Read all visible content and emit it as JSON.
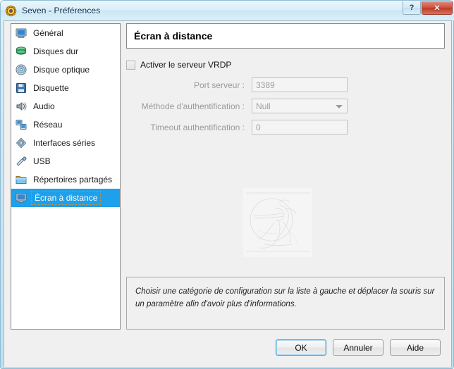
{
  "window": {
    "title": "Seven - Préférences",
    "icon": "gear-icon",
    "caption": {
      "help_label": "?",
      "close_label": "✕"
    }
  },
  "sidebar": {
    "items": [
      {
        "label": "Général",
        "icon": "monitor-icon",
        "selected": false
      },
      {
        "label": "Disques dur",
        "icon": "hard-disk-icon",
        "selected": false
      },
      {
        "label": "Disque optique",
        "icon": "optical-disc-icon",
        "selected": false
      },
      {
        "label": "Disquette",
        "icon": "floppy-disk-icon",
        "selected": false
      },
      {
        "label": "Audio",
        "icon": "speaker-icon",
        "selected": false
      },
      {
        "label": "Réseau",
        "icon": "network-icon",
        "selected": false
      },
      {
        "label": "Interfaces séries",
        "icon": "serial-port-icon",
        "selected": false
      },
      {
        "label": "USB",
        "icon": "usb-icon",
        "selected": false
      },
      {
        "label": "Répertoires partagés",
        "icon": "shared-folder-icon",
        "selected": false
      },
      {
        "label": "Écran à distance",
        "icon": "remote-display-icon",
        "selected": true
      }
    ]
  },
  "panel": {
    "header": "Écran à distance",
    "enable_vrdp": {
      "label": "Activer le serveur VRDP",
      "checked": false
    },
    "fields": [
      {
        "label": "Port serveur :",
        "value": "3389",
        "type": "text",
        "disabled": true
      },
      {
        "label": "Méthode d'authentification :",
        "value": "Null",
        "type": "combo",
        "disabled": true
      },
      {
        "label": "Timeout authentification :",
        "value": "0",
        "type": "text",
        "disabled": true
      }
    ],
    "watermark": "engraving-watermark"
  },
  "hint": {
    "text": "Choisir une catégorie de configuration sur la liste à gauche et déplacer la souris sur un paramètre afin d'avoir plus d'informations."
  },
  "footer": {
    "buttons": [
      {
        "label": "OK",
        "default": true
      },
      {
        "label": "Annuler",
        "default": false
      },
      {
        "label": "Aide",
        "default": false
      }
    ]
  },
  "colors": {
    "selection_blue": "#1ea0ea",
    "focus_orange": "#e08a20",
    "close_red": "#cf5240",
    "panel_grey": "#f0f0f0"
  }
}
